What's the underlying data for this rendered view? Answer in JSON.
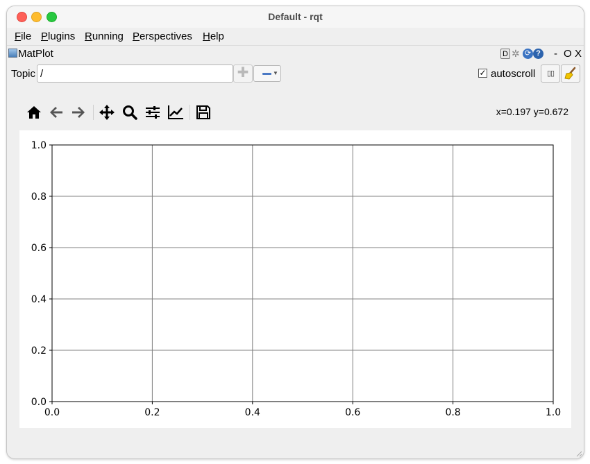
{
  "window": {
    "title": "Default - rqt"
  },
  "menu": {
    "items": [
      {
        "key": "F",
        "rest": "ile"
      },
      {
        "key": "P",
        "rest": "lugins"
      },
      {
        "key": "R",
        "rest": "unning"
      },
      {
        "key": "P",
        "rest": "erspectives"
      },
      {
        "key": "H",
        "rest": "elp"
      }
    ]
  },
  "dock": {
    "title": "MatPlot",
    "d_label": "D",
    "help_glyph": "?",
    "minimize_label": "-",
    "float_label": "O",
    "close_label": "X"
  },
  "topic": {
    "label": "Topic",
    "value": "/",
    "add_icon": "plus-icon",
    "remove_icon": "minus-icon",
    "autoscroll_label": "autoscroll",
    "autoscroll_checked": true,
    "check_mark": "✓",
    "pause_icon": "pause-icon",
    "clear_icon": "broom-icon"
  },
  "toolbar": {
    "icons": [
      "home-icon",
      "back-arrow-icon",
      "forward-arrow-icon",
      "pan-icon",
      "zoom-icon",
      "configure-subplots-icon",
      "edit-axis-icon",
      "save-icon"
    ],
    "coords_text": "x=0.197 y=0.672"
  },
  "colors": {
    "window_bg": "#efefef",
    "grid": "#808080",
    "axis": "#000000",
    "remove_accent": "#4a79c4"
  },
  "chart_data": {
    "type": "line",
    "series": [],
    "x": [],
    "xlim": [
      0.0,
      1.0
    ],
    "ylim": [
      0.0,
      1.0
    ],
    "xticks": [
      "0.0",
      "0.2",
      "0.4",
      "0.6",
      "0.8",
      "1.0"
    ],
    "yticks": [
      "0.0",
      "0.2",
      "0.4",
      "0.6",
      "0.8",
      "1.0"
    ],
    "grid": true,
    "title": "",
    "xlabel": "",
    "ylabel": ""
  }
}
